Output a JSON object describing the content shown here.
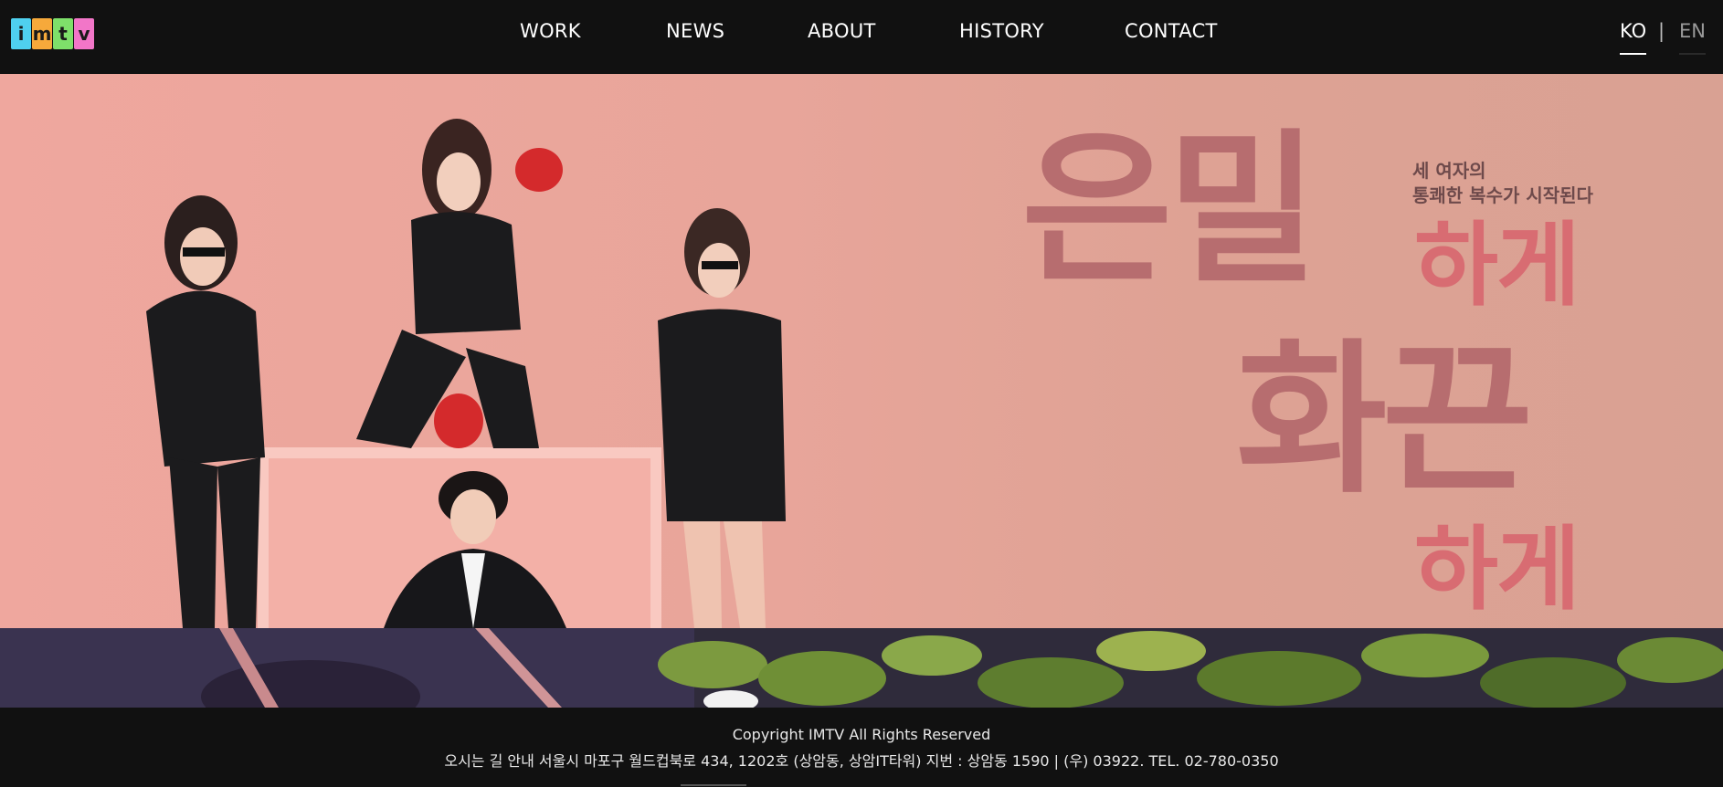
{
  "header": {
    "logo_letters": [
      "i",
      "m",
      "t",
      "v"
    ],
    "logo_colors": [
      "#4fd0ef",
      "#f6a93b",
      "#7ee06a",
      "#f276c8"
    ],
    "nav": [
      {
        "label": "WORK"
      },
      {
        "label": "NEWS"
      },
      {
        "label": "ABOUT"
      },
      {
        "label": "HISTORY"
      },
      {
        "label": "CONTACT"
      }
    ],
    "lang": {
      "ko": "KO",
      "separator": "|",
      "en": "EN",
      "active": "KO"
    }
  },
  "hero": {
    "title_line1": "은밀",
    "title_line1_suffix": "하게",
    "title_line2": "화끈",
    "title_line2_suffix": "하게",
    "tagline_line1": "세 여자의",
    "tagline_line2": "통쾌한 복수가 시작된다",
    "colors": {
      "background": "#e8a59a",
      "title": "#b76d6f",
      "accent": "#d86c72"
    }
  },
  "footer": {
    "copyright": "Copyright IMTV All Rights Reserved",
    "address": "오시는 길 안내 서울시 마포구 월드컵북로 434, 1202호 (상암동, 상암IT타워) 지번 : 상암동 1590 | (우) 03922. TEL. 02-780-0350"
  }
}
